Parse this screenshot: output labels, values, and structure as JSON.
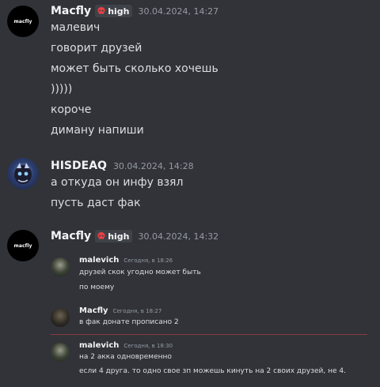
{
  "groups": [
    {
      "username": "Macfly",
      "tag": "high",
      "timestamp": "30.04.2024, 14:27",
      "avatar_text": "macfly",
      "messages": [
        "малевич",
        "говорит друзей",
        "может быть сколько хочешь",
        ")))))",
        "короче",
        "диману напиши"
      ]
    },
    {
      "username": "HISDEAQ",
      "timestamp": "30.04.2024, 14:28",
      "messages": [
        "а откуда он инфу взял",
        "пусть даст фак"
      ]
    },
    {
      "username": "Macfly",
      "tag": "high",
      "timestamp": "30.04.2024, 14:32",
      "avatar_text": "macfly"
    }
  ],
  "quoted": [
    {
      "name": "malevich",
      "time": "Сегодня, в 18:26",
      "lines": [
        "друзей скок угодно может быть",
        "по моему"
      ]
    },
    {
      "name": "Macfly",
      "time": "Сегодня, в 18:27",
      "lines": [
        "в фак донате прописано 2"
      ]
    },
    {
      "name": "malevich",
      "time": "Сегодня, в 18:30",
      "lines": [
        "на 2 акка одновременно",
        "если 4 друга. то одно свое зп можешь кинуть на 2 своих друзей, не 4."
      ]
    }
  ],
  "colors": {
    "background": "#313338",
    "tag_bg": "#3f4248",
    "tag_icon": "#f23f43",
    "divider": "#8a3a3f"
  },
  "icons": {
    "tag_icon": "skull-icon"
  }
}
